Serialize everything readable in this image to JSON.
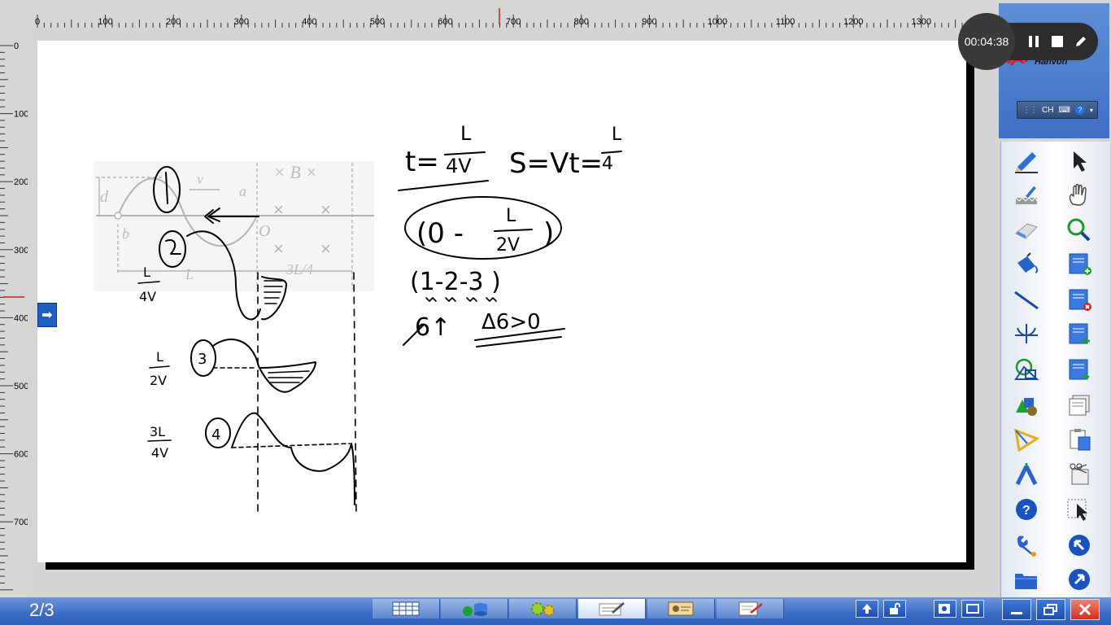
{
  "ruler": {
    "h_labels": [
      "0",
      "100",
      "200",
      "300",
      "400",
      "500",
      "600",
      "700",
      "800",
      "900",
      "1000",
      "1100",
      "1200",
      "1300"
    ],
    "v_labels": [
      "0",
      "100",
      "200",
      "300",
      "400",
      "500",
      "600",
      "700"
    ]
  },
  "recorder": {
    "time": "00:04:38"
  },
  "brand": {
    "name": "Hanvon"
  },
  "ime": {
    "lang": "CH",
    "help": "?"
  },
  "side_arrow": "➡",
  "taskbar": {
    "page": "2/3"
  },
  "figure": {
    "labels": [
      "d",
      "v",
      "a",
      "× B ×",
      "b",
      "O",
      "L",
      "3L/4"
    ]
  },
  "tools": [
    "pen-icon",
    "select-arrow-icon",
    "brush-icon",
    "hand-icon",
    "eraser-icon",
    "magnifier-icon",
    "fill-bucket-icon",
    "new-page-icon",
    "line-icon",
    "delete-page-icon",
    "axis-icon",
    "prev-page-icon",
    "shapes-icon",
    "next-page-icon",
    "3d-shapes-icon",
    "page-list-icon",
    "protractor-icon",
    "clipboard-icon",
    "compass-icon",
    "cut-icon",
    "help-icon",
    "area-select-icon",
    "settings-wrench-icon",
    "back-arrow-icon",
    "folder-icon",
    "forward-arrow-icon"
  ]
}
